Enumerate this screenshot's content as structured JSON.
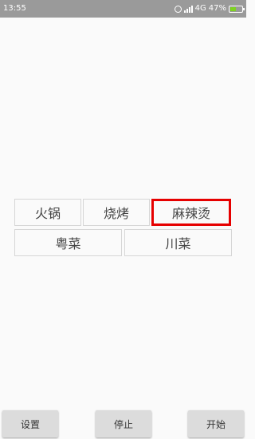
{
  "status_bar": {
    "time": "13:55",
    "network": "4G",
    "battery_percent": "47%",
    "battery_level": 0.47,
    "alarm_icon": "alarm-clock-icon",
    "signal_icon": "cellular-signal-icon",
    "battery_icon": "battery-charging-icon",
    "battery_color": "#7ed321"
  },
  "food_options": [
    {
      "label": "火锅",
      "selected": false
    },
    {
      "label": "烧烤",
      "selected": false
    },
    {
      "label": "麻辣烫",
      "selected": true
    },
    {
      "label": "粤菜",
      "selected": false
    },
    {
      "label": "川菜",
      "selected": false
    }
  ],
  "highlight_color": "#e60000",
  "buttons": {
    "settings": "设置",
    "stop": "停止",
    "start": "开始"
  }
}
